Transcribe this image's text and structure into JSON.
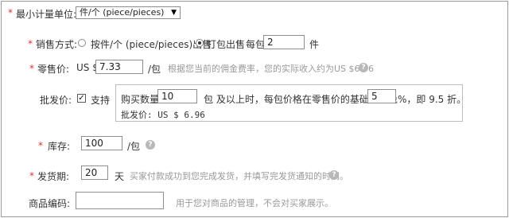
{
  "min_unit": {
    "required": "*",
    "label": "最小计量单位:",
    "value": "件/个 (piece/pieces)"
  },
  "sale_method": {
    "required": "*",
    "label": "销售方式:",
    "option1": "按件/个 (piece/pieces)出售",
    "option2": "打包出售",
    "per_pack_label": "每包",
    "per_pack_value": "2",
    "per_pack_unit": "件",
    "selected": "option2"
  },
  "retail_price": {
    "required": "*",
    "label": "零售价:",
    "currency": "US $",
    "value": "7.33",
    "unit": "/包",
    "hint": "根据您当前的佣金费率，您的实际收入约为US $6.96"
  },
  "wholesale": {
    "label": "批发价:",
    "enabled": true,
    "enable_label": "支持",
    "qty_label": "购买数量",
    "qty_value": "10",
    "text_mid": "包 及以上时，每包价格在零售价的基础上减免",
    "discount_value": "5",
    "text_end": "%，即 9.5 折。",
    "price_text": "批发价: US $ 6.96"
  },
  "stock": {
    "required": "*",
    "label": "库存:",
    "value": "100",
    "unit": "/包"
  },
  "shipping": {
    "required": "*",
    "label": "发货期:",
    "value": "20",
    "unit": "天",
    "hint": "买家付款成功到您完成发货，并填写完发货通知的时间。"
  },
  "product_code": {
    "label": "商品编码:",
    "value": "",
    "hint": "用于您对商品的管理，不会对买家展示。"
  },
  "icons": {
    "help": "?",
    "check": "✓",
    "dropdown": "▼"
  }
}
